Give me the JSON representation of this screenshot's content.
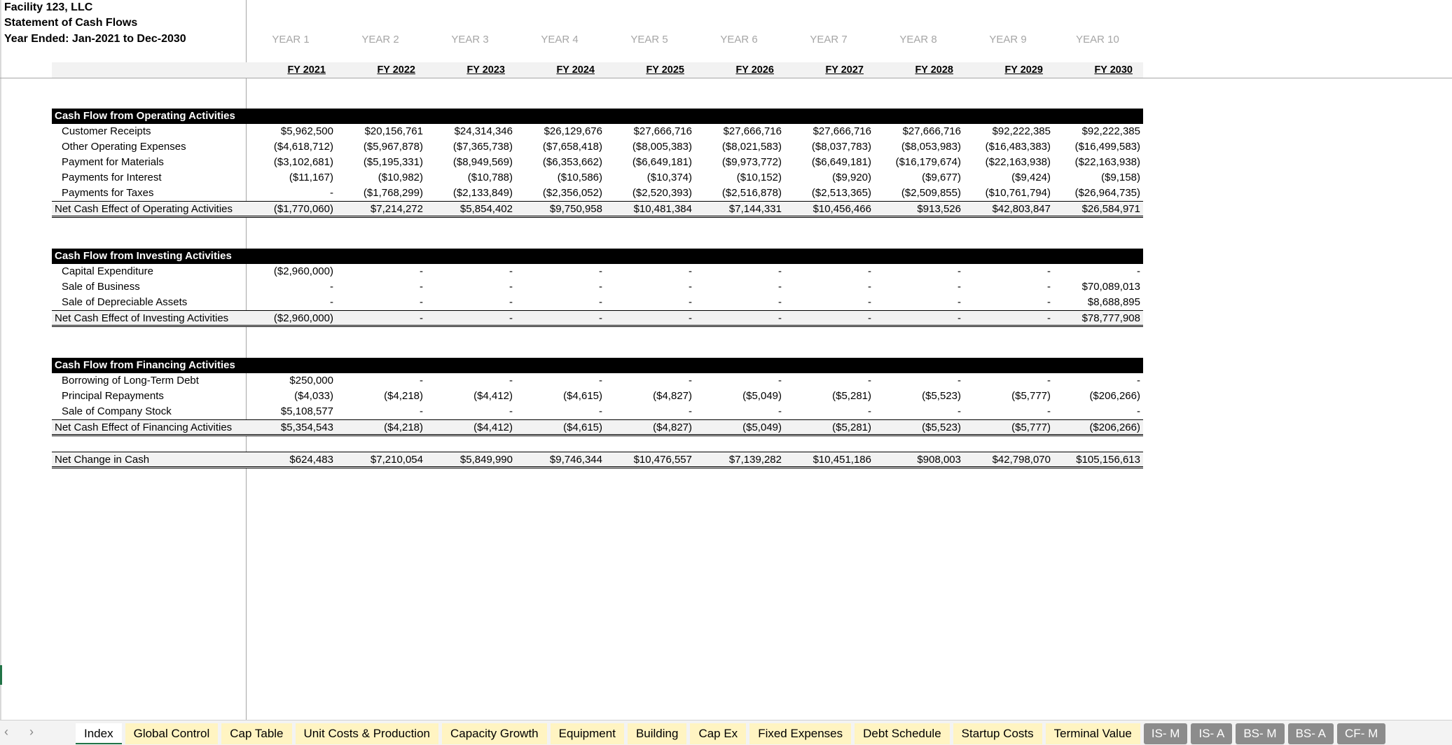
{
  "header": {
    "company": "Facility 123, LLC",
    "statement": "Statement of Cash Flows",
    "period": "Year Ended: Jan-2021 to Dec-2030"
  },
  "years": [
    "YEAR 1",
    "YEAR 2",
    "YEAR 3",
    "YEAR 4",
    "YEAR 5",
    "YEAR 6",
    "YEAR 7",
    "YEAR 8",
    "YEAR 9",
    "YEAR 10"
  ],
  "fiscal_years": [
    "FY 2021",
    "FY 2022",
    "FY 2023",
    "FY 2024",
    "FY 2025",
    "FY 2026",
    "FY 2027",
    "FY 2028",
    "FY 2029",
    "FY 2030"
  ],
  "operating": {
    "title": "Cash Flow from Operating Activities",
    "rows": [
      {
        "label": "Customer Receipts",
        "values": [
          "$5,962,500",
          "$20,156,761",
          "$24,314,346",
          "$26,129,676",
          "$27,666,716",
          "$27,666,716",
          "$27,666,716",
          "$27,666,716",
          "$92,222,385",
          "$92,222,385"
        ]
      },
      {
        "label": "Other Operating Expenses",
        "values": [
          "($4,618,712)",
          "($5,967,878)",
          "($7,365,738)",
          "($7,658,418)",
          "($8,005,383)",
          "($8,021,583)",
          "($8,037,783)",
          "($8,053,983)",
          "($16,483,383)",
          "($16,499,583)"
        ]
      },
      {
        "label": "Payment for Materials",
        "values": [
          "($3,102,681)",
          "($5,195,331)",
          "($8,949,569)",
          "($6,353,662)",
          "($6,649,181)",
          "($9,973,772)",
          "($6,649,181)",
          "($16,179,674)",
          "($22,163,938)",
          "($22,163,938)"
        ]
      },
      {
        "label": "Payments for Interest",
        "values": [
          "($11,167)",
          "($10,982)",
          "($10,788)",
          "($10,586)",
          "($10,374)",
          "($10,152)",
          "($9,920)",
          "($9,677)",
          "($9,424)",
          "($9,158)"
        ]
      },
      {
        "label": "Payments for Taxes",
        "values": [
          "-",
          "($1,768,299)",
          "($2,133,849)",
          "($2,356,052)",
          "($2,520,393)",
          "($2,516,878)",
          "($2,513,365)",
          "($2,509,855)",
          "($10,761,794)",
          "($26,964,735)"
        ]
      }
    ],
    "total": {
      "label": "Net Cash Effect of Operating Activities",
      "values": [
        "($1,770,060)",
        "$7,214,272",
        "$5,854,402",
        "$9,750,958",
        "$10,481,384",
        "$7,144,331",
        "$10,456,466",
        "$913,526",
        "$42,803,847",
        "$26,584,971"
      ]
    }
  },
  "investing": {
    "title": "Cash Flow from Investing Activities",
    "rows": [
      {
        "label": "Capital Expenditure",
        "values": [
          "($2,960,000)",
          "-",
          "-",
          "-",
          "-",
          "-",
          "-",
          "-",
          "-",
          "-"
        ]
      },
      {
        "label": "Sale of Business",
        "values": [
          "-",
          "-",
          "-",
          "-",
          "-",
          "-",
          "-",
          "-",
          "-",
          "$70,089,013"
        ]
      },
      {
        "label": "Sale of Depreciable Assets",
        "values": [
          "-",
          "-",
          "-",
          "-",
          "-",
          "-",
          "-",
          "-",
          "-",
          "$8,688,895"
        ]
      }
    ],
    "total": {
      "label": "Net Cash Effect of Investing Activities",
      "values": [
        "($2,960,000)",
        "-",
        "-",
        "-",
        "-",
        "-",
        "-",
        "-",
        "-",
        "$78,777,908"
      ]
    }
  },
  "financing": {
    "title": "Cash Flow from Financing Activities",
    "rows": [
      {
        "label": "Borrowing of Long-Term Debt",
        "values": [
          "$250,000",
          "-",
          "-",
          "-",
          "-",
          "-",
          "-",
          "-",
          "-",
          "-"
        ]
      },
      {
        "label": "Principal Repayments",
        "values": [
          "($4,033)",
          "($4,218)",
          "($4,412)",
          "($4,615)",
          "($4,827)",
          "($5,049)",
          "($5,281)",
          "($5,523)",
          "($5,777)",
          "($206,266)"
        ]
      },
      {
        "label": "Sale of Company Stock",
        "values": [
          "$5,108,577",
          "-",
          "-",
          "-",
          "-",
          "-",
          "-",
          "-",
          "-",
          "-"
        ]
      }
    ],
    "total": {
      "label": "Net Cash Effect of Financing Activities",
      "values": [
        "$5,354,543",
        "($4,218)",
        "($4,412)",
        "($4,615)",
        "($4,827)",
        "($5,049)",
        "($5,281)",
        "($5,523)",
        "($5,777)",
        "($206,266)"
      ]
    }
  },
  "net_change": {
    "label": "Net Change in Cash",
    "values": [
      "$624,483",
      "$7,210,054",
      "$5,849,990",
      "$9,746,344",
      "$10,476,557",
      "$7,139,282",
      "$10,451,186",
      "$908,003",
      "$42,798,070",
      "$105,156,613"
    ]
  },
  "tabbar": {
    "prev_icon": "‹",
    "next_icon": "›",
    "tabs": [
      {
        "label": "Index",
        "style": "active"
      },
      {
        "label": "Global Control",
        "style": "yellow"
      },
      {
        "label": "Cap Table",
        "style": "yellow"
      },
      {
        "label": "Unit Costs & Production",
        "style": "yellow"
      },
      {
        "label": "Capacity Growth",
        "style": "yellow"
      },
      {
        "label": "Equipment",
        "style": "yellow"
      },
      {
        "label": "Building",
        "style": "yellow"
      },
      {
        "label": "Cap Ex",
        "style": "yellow"
      },
      {
        "label": "Fixed Expenses",
        "style": "yellow"
      },
      {
        "label": "Debt Schedule",
        "style": "yellow"
      },
      {
        "label": "Startup Costs",
        "style": "yellow"
      },
      {
        "label": "Terminal Value",
        "style": "yellow"
      },
      {
        "label": "IS- M",
        "style": "gray"
      },
      {
        "label": "IS- A",
        "style": "gray"
      },
      {
        "label": "BS- M",
        "style": "gray"
      },
      {
        "label": "BS- A",
        "style": "gray"
      },
      {
        "label": "CF- M",
        "style": "gray"
      }
    ]
  }
}
